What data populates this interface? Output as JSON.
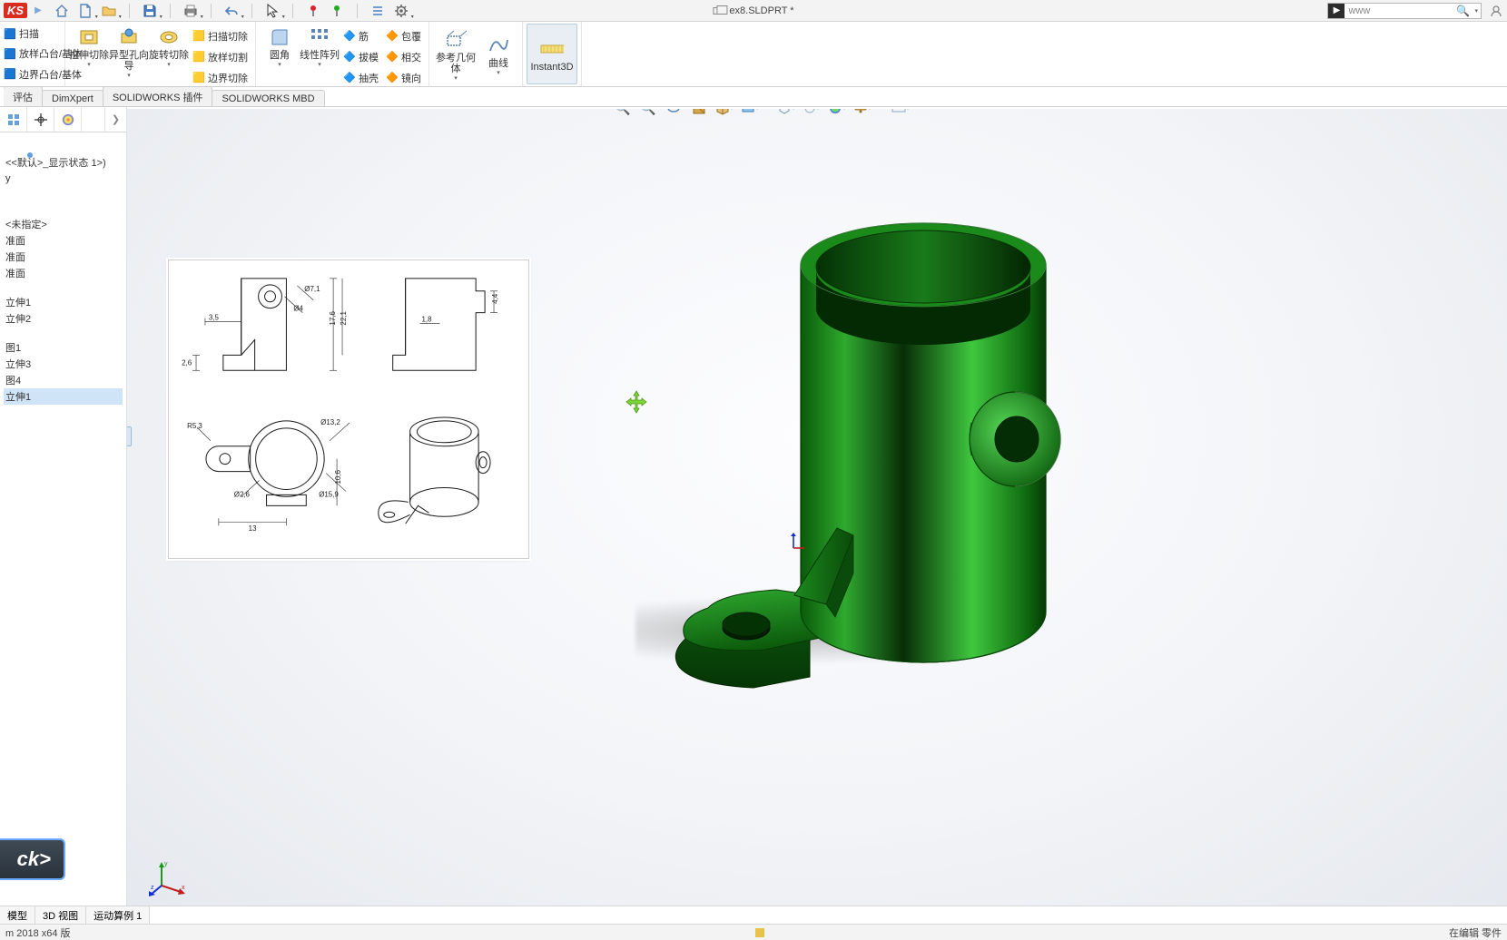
{
  "logo_fragment": "KS",
  "document_title": "ex8.SLDPRT *",
  "search": {
    "placeholder": "www"
  },
  "ribbon": {
    "left_stack": [
      "扫描",
      "放样凸台/基体",
      "边界凸台/基体"
    ],
    "extrude_cut": "拉伸切除",
    "hole_wizard": "异型孔向导",
    "revolve_cut": "旋转切除",
    "loft_cut": "放样切割",
    "swept_cut": "扫描切除",
    "boundary_cut": "边界切除",
    "fillet": "圆角",
    "linear_pattern": "线性阵列",
    "rib": "筋",
    "draft": "拔模",
    "shell": "抽壳",
    "wrap": "包覆",
    "intersect": "相交",
    "mirror": "镜向",
    "ref_geom": "参考几何体",
    "curves": "曲线",
    "instant3d": "Instant3D"
  },
  "tabs": [
    "评估",
    "DimXpert",
    "SOLIDWORKS 插件",
    "SOLIDWORKS MBD"
  ],
  "panel": {
    "display_state": "<<默认>_显示状态 1>)",
    "items": [
      "y",
      " ",
      "<未指定>",
      "准面",
      "准面",
      "准面",
      " ",
      "立伸1",
      "立伸2",
      " ",
      "图1",
      "立伸3",
      "图4"
    ],
    "selected": "立伸1"
  },
  "blueprint_dims": {
    "d1": "3,5",
    "d2": "2,6",
    "d3": "17,6",
    "d4": "22,1",
    "d5": "1,8",
    "d6": "4,4",
    "d7": "Ø2,6",
    "d8": "R5,3",
    "d9": "Ø13,2",
    "d10": "10,6",
    "d11": "Ø15,9",
    "d12": "13",
    "d13": "Ø7,1",
    "d14": "Ø4"
  },
  "bottom_tabs": [
    "模型",
    "3D 视图",
    "运动算例 1"
  ],
  "status": {
    "version": "m 2018 x64 版",
    "mode": "在编辑 零件"
  },
  "ck_label": "ck>"
}
